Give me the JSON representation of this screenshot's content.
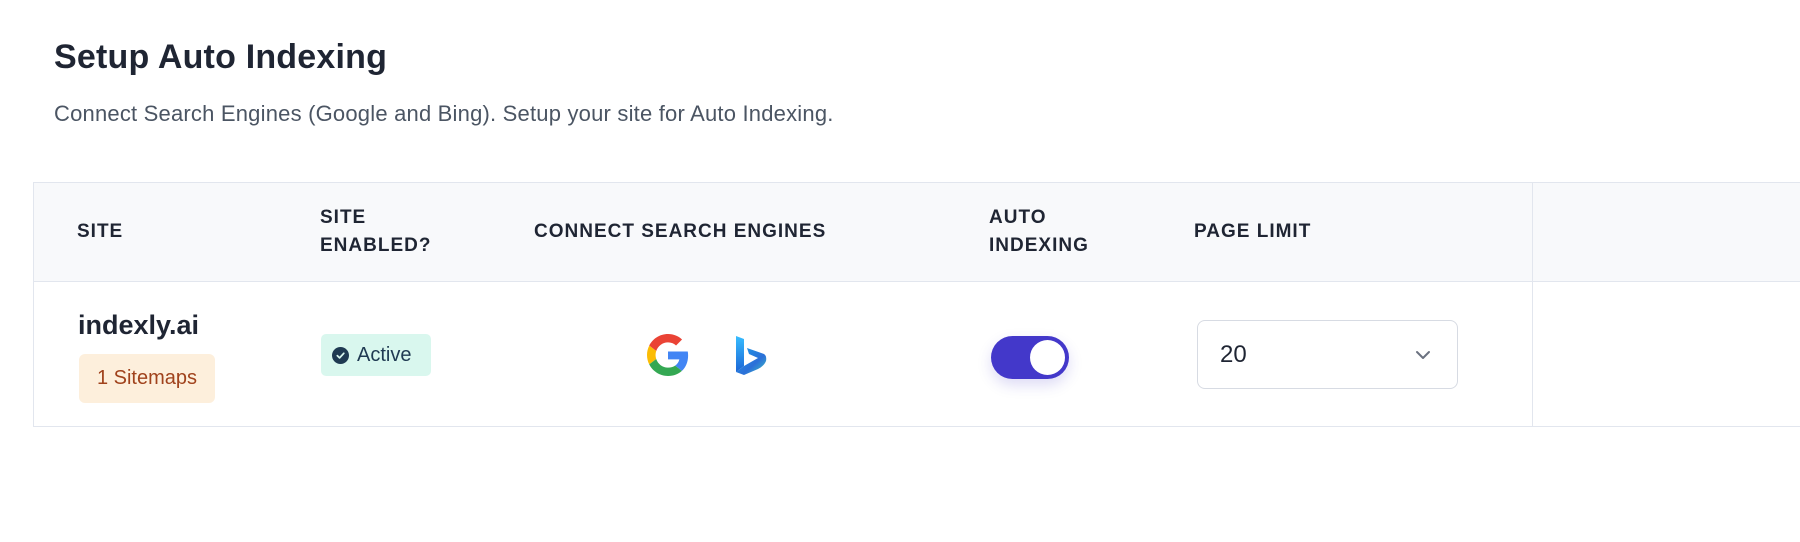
{
  "header": {
    "title": "Setup Auto Indexing",
    "subtitle": "Connect Search Engines (Google and Bing). Setup your site for Auto Indexing."
  },
  "table": {
    "columns": [
      "SITE",
      "SITE ENABLED?",
      "CONNECT SEARCH ENGINES",
      "AUTO INDEXING",
      "PAGE LIMIT"
    ],
    "rows": [
      {
        "site": "indexly.ai",
        "sitemaps": "1 Sitemaps",
        "status": "Active",
        "engines": [
          "google-icon",
          "bing-icon"
        ],
        "auto_indexing_on": true,
        "page_limit": "20"
      }
    ]
  },
  "colors": {
    "accent": "#4338ca",
    "status_bg": "#d9f7ee",
    "badge_bg": "#fdefdc",
    "badge_text": "#a0421c"
  }
}
